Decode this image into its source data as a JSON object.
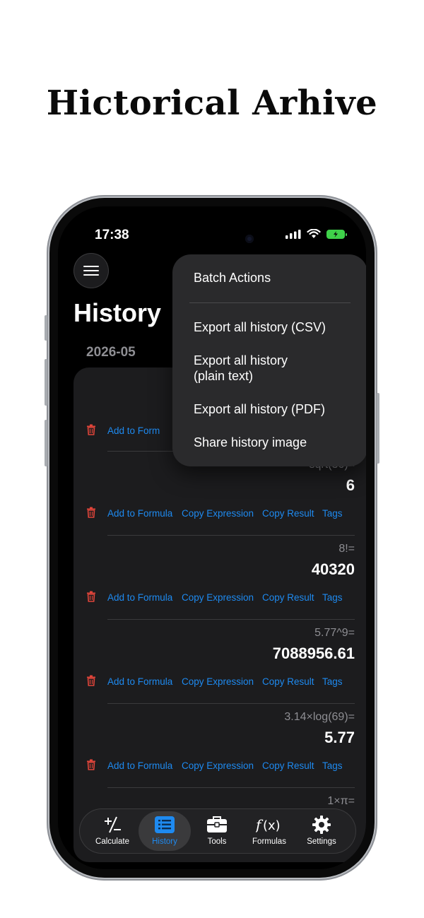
{
  "headline": "Hictorical Arhive",
  "status": {
    "time": "17:38"
  },
  "page": {
    "title": "History",
    "month": "2026-05"
  },
  "entries": [
    {
      "expr": "",
      "result": ""
    },
    {
      "expr": "sqrt(36)=",
      "result": "6"
    },
    {
      "expr": "8!=",
      "result": "40320"
    },
    {
      "expr": "5.77^9=",
      "result": "7088956.61"
    },
    {
      "expr": "3.14×log(69)=",
      "result": "5.77"
    },
    {
      "expr": "1×π=",
      "result": ""
    }
  ],
  "actions": {
    "add_formula": "Add to Formula",
    "add_formula_truncated": "Add to Form",
    "copy_expression": "Copy Expression",
    "copy_result": "Copy Result",
    "tags": "Tags"
  },
  "popup": {
    "title": "Batch Actions",
    "items": [
      "Export all history (CSV)",
      "Export all history (plain text)",
      "Export all history (PDF)",
      "Share history image"
    ],
    "items_display": {
      "csv": "Export all history (CSV)",
      "plain_line1": "Export all history",
      "plain_line2": "(plain text)",
      "pdf": "Export all history (PDF)",
      "share": "Share history image"
    }
  },
  "tabs": [
    {
      "label": "Calculate",
      "icon": "plus-minus-icon"
    },
    {
      "label": "History",
      "icon": "list-icon",
      "active": true
    },
    {
      "label": "Tools",
      "icon": "toolbox-icon"
    },
    {
      "label": "Formulas",
      "icon": "function-icon"
    },
    {
      "label": "Settings",
      "icon": "gear-icon"
    }
  ],
  "colors": {
    "accent": "#1e8af0",
    "delete": "#e0453a",
    "background": "#000000",
    "card": "#1c1c1e"
  }
}
